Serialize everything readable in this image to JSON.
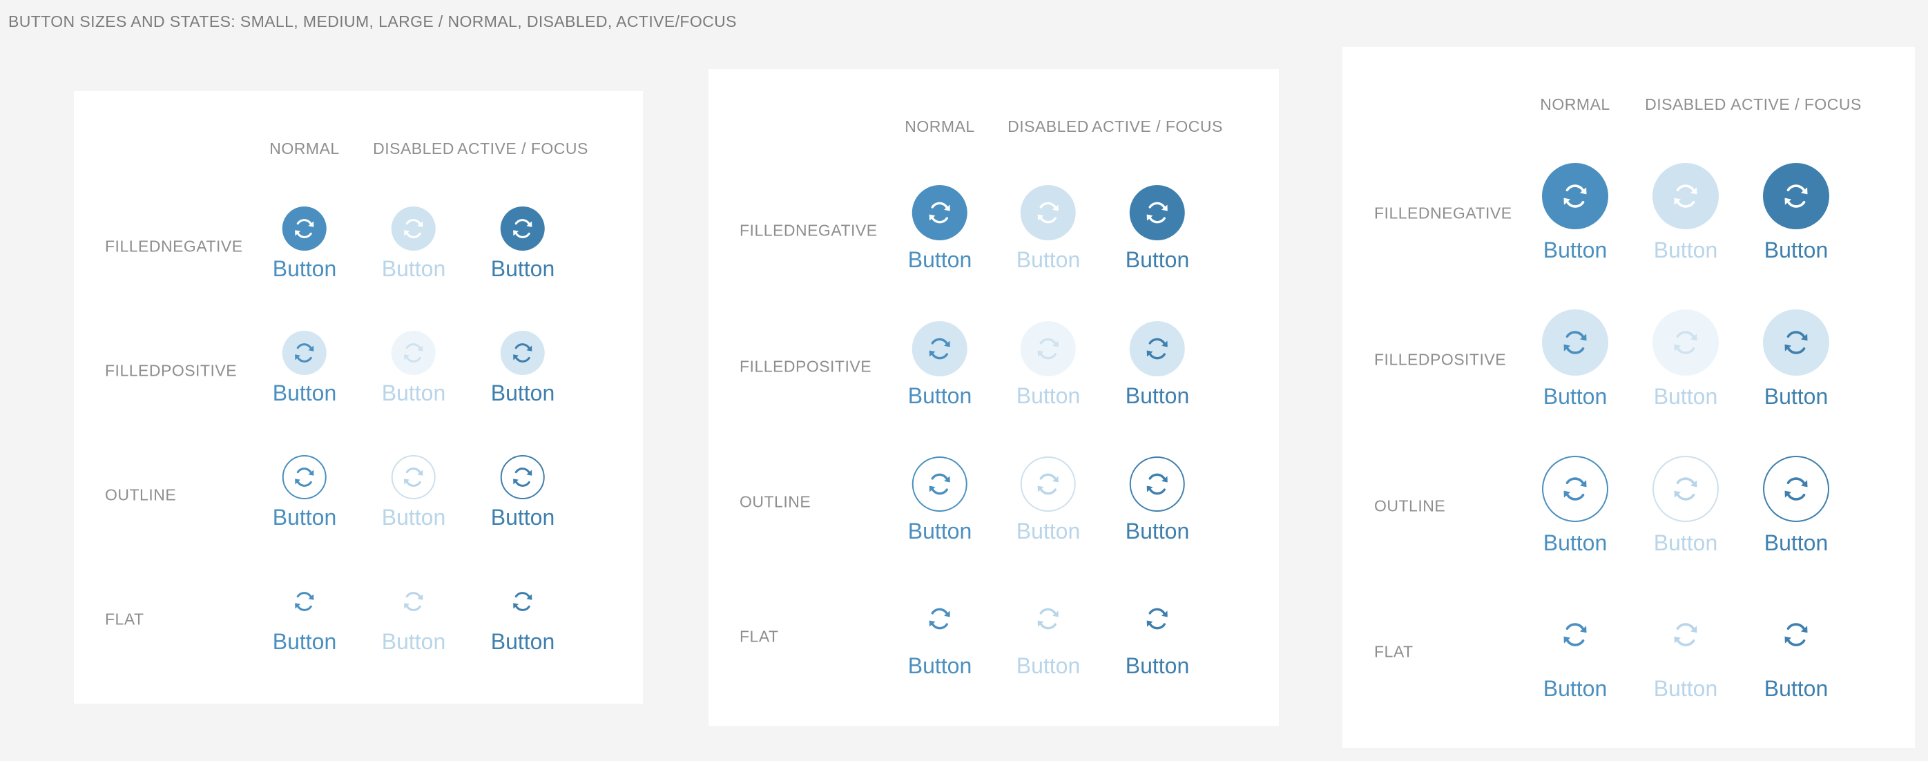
{
  "title": "BUTTON SIZES AND STATES: SMALL, MEDIUM, LARGE / NORMAL, DISABLED, ACTIVE/FOCUS",
  "icon": "refresh-icon",
  "colors": {
    "page_bg": "#f4f4f4",
    "panel_bg": "#ffffff",
    "accent": "#4a8fbf",
    "accent_dark": "#3e7fae",
    "disabled_fill": "#cfe2ef",
    "disabled_text": "#b8d5e9",
    "positive_fill": "#d4e6f2",
    "positive_disabled_fill": "#eef5fa",
    "label_gray": "#8e8e8e"
  },
  "column_headers": [
    "NORMAL",
    "DISABLED",
    "ACTIVE / FOCUS"
  ],
  "states": [
    "normal",
    "disabled",
    "active"
  ],
  "variants": [
    {
      "key": "filled-negative",
      "label": "FILLEDNEGATIVE"
    },
    {
      "key": "filled-positive",
      "label": "FILLEDPOSITIVE"
    },
    {
      "key": "outline",
      "label": "OUTLINE"
    },
    {
      "key": "flat",
      "label": "FLAT"
    }
  ],
  "button_label": "Button",
  "panels": [
    {
      "size": "small"
    },
    {
      "size": "medium"
    },
    {
      "size": "large"
    }
  ]
}
